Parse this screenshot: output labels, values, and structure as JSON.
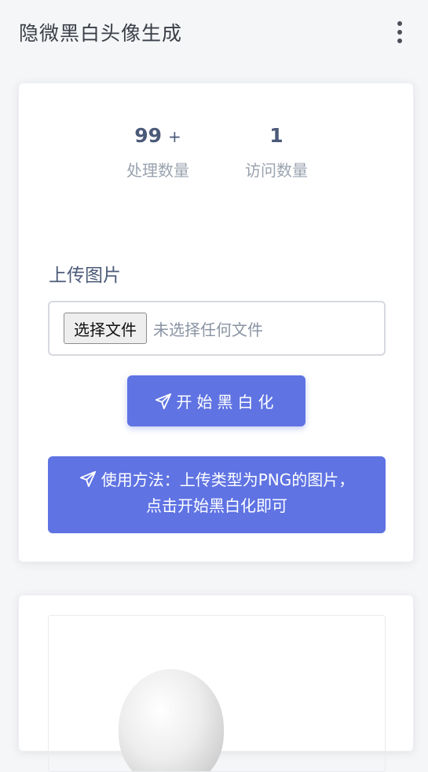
{
  "appbar": {
    "title": "隐微黑白头像生成",
    "menu_icon": "more-vertical-icon"
  },
  "stats": [
    {
      "value": "99",
      "suffix": "+",
      "label": "处理数量"
    },
    {
      "value": "1",
      "label": "访问数量"
    }
  ],
  "upload": {
    "label": "上传图片",
    "choose_button": "选择文件",
    "status_text": "未选择任何文件"
  },
  "start_button": {
    "label": "开始黑白化",
    "icon": "send-icon"
  },
  "notice": {
    "text": "使用方法：上传类型为PNG的图片，点击开始黑白化即可",
    "icon": "send-icon"
  },
  "colors": {
    "accent": "#5f73e3",
    "stat_text": "#4b5a78",
    "muted": "#9aa3af"
  }
}
